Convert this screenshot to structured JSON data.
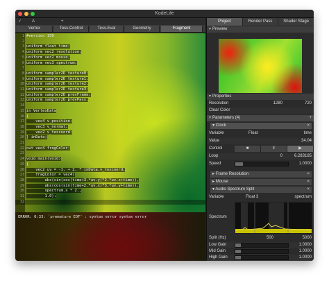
{
  "window": {
    "title": "KodeLife",
    "traffic_colors": [
      "#fc5753",
      "#fdbc40",
      "#33c748"
    ]
  },
  "file_tabs": {
    "checkbox": "✓",
    "name": "A",
    "plus": "+"
  },
  "shader_tabs": [
    "Vertex",
    "Tess.Control",
    "Tess.Eval",
    "Geometry",
    "Fragment"
  ],
  "shader_tabs_active": "Fragment",
  "code_lines": [
    {
      "n": "1",
      "text": "#version 150"
    },
    {
      "n": "2",
      "text": ""
    },
    {
      "n": "3",
      "text": "uniform float time;"
    },
    {
      "n": "4",
      "text": "uniform vec2 resolution;"
    },
    {
      "n": "5",
      "text": "uniform vec2 mouse;"
    },
    {
      "n": "6",
      "text": "uniform vec3 spectrum;"
    },
    {
      "n": "7",
      "text": ""
    },
    {
      "n": "8",
      "text": "uniform sampler2D texture0;"
    },
    {
      "n": "9",
      "text": "uniform sampler2D texture1;"
    },
    {
      "n": "10",
      "text": "uniform sampler2D texture2;"
    },
    {
      "n": "11",
      "text": "uniform sampler2D texture3;"
    },
    {
      "n": "12",
      "text": "uniform sampler2D prevFrame;"
    },
    {
      "n": "13",
      "text": "uniform sampler2D prevPass;"
    },
    {
      "n": "14",
      "text": ""
    },
    {
      "n": "15",
      "text": "in VertexData"
    },
    {
      "n": "16",
      "text": "{"
    },
    {
      "n": "17",
      "text": "    vec4 v_position;"
    },
    {
      "n": "18",
      "text": "    vec3 v_normal;"
    },
    {
      "n": "19",
      "text": "    vec2 v_texcoord;"
    },
    {
      "n": "20",
      "text": "} inData;"
    },
    {
      "n": "21",
      "text": ""
    },
    {
      "n": "22",
      "text": "out vec4 fragColor;"
    },
    {
      "n": "23",
      "text": ""
    },
    {
      "n": "24",
      "text": "void main(void)"
    },
    {
      "n": "25",
      "text": "{"
    },
    {
      "n": "26",
      "text": "    vec2 uv = -1. + 2. * inData.v_texcoord;"
    },
    {
      "n": "27",
      "text": "    fragColor = vec4("
    },
    {
      "n": "28",
      "text": "        abs(sin(cos(time+3.*uv.y)*2.*uv.x+time)),"
    },
    {
      "n": "29",
      "text": "        abs(cos(sin(time+2.*uv.x)*3.*uv.y+time)),"
    },
    {
      "n": "30",
      "text": "        spectrum.x * 2.,"
    },
    {
      "n": "31",
      "text": "        1.0);"
    },
    {
      "n": "32",
      "text": ""
    }
  ],
  "error_message": "ERROR: 0:33: `premature EOF' : syntax error syntax error",
  "panel_tabs": [
    "Project",
    "Render Pass",
    "Shader Stage"
  ],
  "panel_tabs_active": "Project",
  "sections": {
    "preview": "Preview",
    "properties": "Properties"
  },
  "properties": {
    "resolution_label": "Resolution",
    "resolution_w": "1280",
    "resolution_h": "720",
    "clear_color_label": "Clear Color"
  },
  "parameters": {
    "header": "Parameters (4)",
    "add": "+",
    "clock": "Clock"
  },
  "clock_rows": {
    "variable_label": "Variable",
    "variable_type": "Float",
    "variable_name": "time",
    "value_label": "Value",
    "value": "34.04",
    "control_label": "Control",
    "control_buttons": [
      "■",
      "‖",
      "▶"
    ],
    "loop_label": "Loop",
    "loop_from": "0",
    "loop_to": "6.283185",
    "speed_label": "Speed",
    "speed": "1.0000",
    "speed_fraction": 0.15
  },
  "sub_params": [
    "Frame Resolution",
    "Mouse",
    "Audio Spectrum Split"
  ],
  "spectrum_rows": {
    "variable_label": "Variable",
    "variable_type": "Float 3",
    "variable_name": "spectrum",
    "spectrum_label": "Spectrum",
    "split_label": "Split (Hz)",
    "split_a": "500",
    "split_b": "5000",
    "gains": [
      {
        "label": "Low Gain",
        "value": "1.0000",
        "fraction": 0.1
      },
      {
        "label": "Mid Gain",
        "value": "1.0000",
        "fraction": 0.1
      },
      {
        "label": "High Gain",
        "value": "1.0000",
        "fraction": 0.1
      }
    ]
  },
  "colors": {
    "window_bg": "#1e1e1e",
    "panel_bg": "#2b2b2b",
    "spectrum_band": "#c9c200"
  },
  "icons": [
    "checkbox-icon",
    "plus-icon",
    "triangle-down-icon",
    "stop-icon",
    "pause-icon",
    "play-icon",
    "close-x-icon"
  ]
}
